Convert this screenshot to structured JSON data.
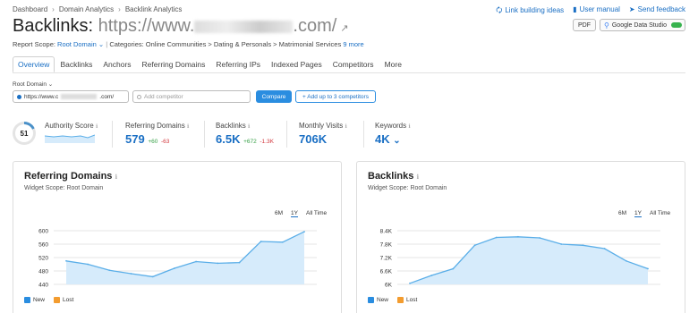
{
  "breadcrumb": [
    "Dashboard",
    "Domain Analytics",
    "Backlink Analytics"
  ],
  "top_links": [
    "Link building ideas",
    "User manual",
    "Send feedback"
  ],
  "title": {
    "prefix": "Backlinks:",
    "url_start": "https://www.",
    "url_end": ".com/"
  },
  "buttons": {
    "pdf": "PDF",
    "gds": "Google Data Studio",
    "compare": "Compare",
    "add": "+ Add up to 3 competitors"
  },
  "scope": {
    "label": "Report Scope:",
    "value": "Root Domain",
    "categories_label": "Categories:",
    "categories": "Online Communities > Dating & Personals > Matrimonial Services",
    "more": "9 more"
  },
  "tabs": [
    "Overview",
    "Backlinks",
    "Anchors",
    "Referring Domains",
    "Referring IPs",
    "Indexed Pages",
    "Competitors",
    "More"
  ],
  "controls": {
    "root_domain_label": "Root Domain",
    "url_prefix": "https://www.c",
    "url_suffix": ".com/",
    "competitor_placeholder": "Add competitor"
  },
  "metrics": {
    "authority": {
      "label": "Authority Score",
      "value": "51",
      "fraction": 0.51
    },
    "referring_domains": {
      "label": "Referring Domains",
      "value": "579",
      "new": "+60",
      "lost": "-63"
    },
    "backlinks": {
      "label": "Backlinks",
      "value": "6.5K",
      "new": "+672",
      "lost": "-1.3K"
    },
    "monthly_visits": {
      "label": "Monthly Visits",
      "value": "706K"
    },
    "keywords": {
      "label": "Keywords",
      "value": "4K"
    }
  },
  "panels": {
    "rd": {
      "title": "Referring Domains",
      "scope": "Widget Scope: Root Domain"
    },
    "bl": {
      "title": "Backlinks",
      "scope": "Widget Scope: Root Domain"
    },
    "periods": [
      "6M",
      "1Y",
      "All Time"
    ],
    "selected_period": "1Y",
    "legend": [
      "New",
      "Lost"
    ]
  },
  "colors": {
    "accent": "#1a6fc4",
    "line": "#5aaee8",
    "fill": "#d6ebfb",
    "new": "#2a8de0",
    "lost": "#f39c2f"
  },
  "chart_data": [
    {
      "type": "area",
      "title": "Referring Domains",
      "yticks": [
        "600",
        "560",
        "520",
        "480",
        "440"
      ],
      "ylim": [
        440,
        600
      ],
      "values": [
        510,
        500,
        482,
        472,
        463,
        488,
        508,
        503,
        505,
        568,
        566,
        597
      ]
    },
    {
      "type": "area",
      "title": "Backlinks",
      "yticks": [
        "8.4K",
        "7.8K",
        "7.2K",
        "6.6K",
        "6K"
      ],
      "ylim": [
        6000,
        8400
      ],
      "values": [
        6050,
        6400,
        6700,
        7750,
        8100,
        8130,
        8080,
        7800,
        7750,
        7600,
        7050,
        6700
      ]
    }
  ]
}
